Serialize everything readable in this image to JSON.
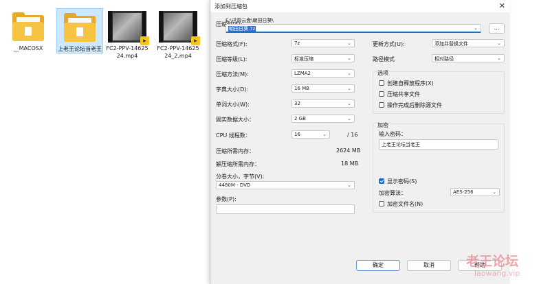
{
  "explorer": {
    "files": [
      {
        "name": "__MACOSX",
        "type": "folder"
      },
      {
        "name": "上老王论坛当老王",
        "type": "folder"
      },
      {
        "name": "FC2-PPV-1462524.mp4",
        "type": "video"
      },
      {
        "name": "FC2-PPV-1462524_2.mp4",
        "type": "video"
      }
    ]
  },
  "dialog": {
    "title": "添加到压缩包",
    "close": "✕",
    "archive": {
      "label": "压缩包(A):",
      "path": "E:\\迅雷云盘\\朝田日葵\\",
      "value": "朝田日葵.7z",
      "browse": "..."
    },
    "format": {
      "label": "压缩格式(F):",
      "value": "7z"
    },
    "level": {
      "label": "压缩等级(L):",
      "value": "标准压缩"
    },
    "method": {
      "label": "压缩方法(M):",
      "value": "LZMA2"
    },
    "dict": {
      "label": "字典大小(D):",
      "value": "16 MB"
    },
    "word": {
      "label": "单词大小(W):",
      "value": "32"
    },
    "solid": {
      "label": "固实数据大小：",
      "value": "2 GB"
    },
    "cpu": {
      "label": "CPU 线程数：",
      "value": "16",
      "total": "/ 16"
    },
    "mem_compress": {
      "label": "压缩所需内存：",
      "value": "2624 MB"
    },
    "mem_decompress": {
      "label": "解压缩所需内存：",
      "value": "18 MB"
    },
    "volume": {
      "label": "分卷大小，字节(V):",
      "value": "4480M - DVD"
    },
    "params": {
      "label": "参数(P):",
      "value": ""
    },
    "update": {
      "label": "更新方式(U):",
      "value": "添加并替换文件"
    },
    "pathmode": {
      "label": "路径模式",
      "value": "相对路径"
    },
    "options": {
      "title": "选项",
      "sfx": "创建自释放程序(X)",
      "shared": "压缩共享文件",
      "delete": "操作完成后删除源文件"
    },
    "encrypt": {
      "title": "加密",
      "pwd_label": "输入密码：",
      "pwd_value": "上老王论坛当老王",
      "show": "显示密码(S)",
      "algo_label": "加密算法：",
      "algo_value": "AES-256",
      "encnames": "加密文件名(N)"
    },
    "buttons": {
      "ok": "确定",
      "cancel": "取消",
      "help": "帮助"
    }
  },
  "watermark": {
    "line1": "老王论坛",
    "line2": "laowang.vip"
  }
}
